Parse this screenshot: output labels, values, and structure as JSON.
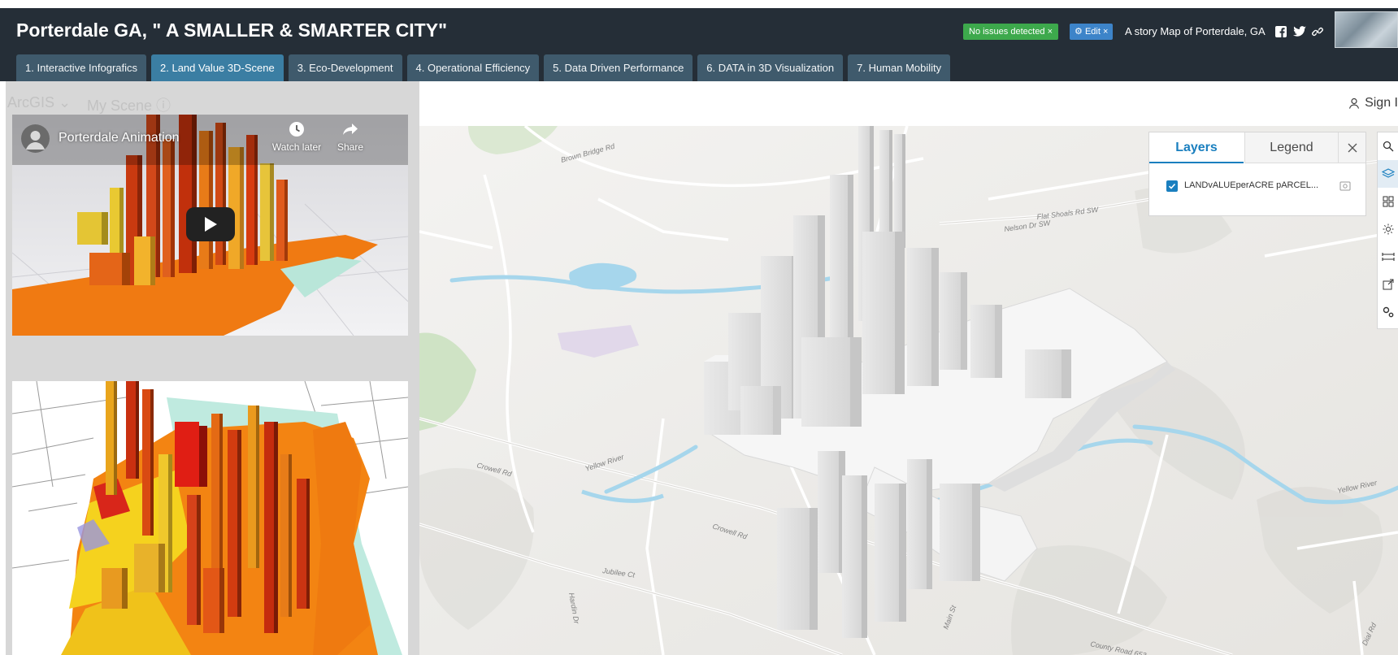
{
  "header": {
    "title": "Porterdale GA, \" A SMALLER & SMARTER CITY\"",
    "status_badge": "No issues detected ×",
    "edit_badge": "Edit ×",
    "story_link": "A story Map of Porterdale, GA",
    "icons": [
      "facebook-icon",
      "twitter-icon",
      "link-icon"
    ]
  },
  "tabs": [
    {
      "label": "1. Interactive Infografics",
      "active": false
    },
    {
      "label": "2. Land Value 3D-Scene",
      "active": true
    },
    {
      "label": "3. Eco-Development",
      "active": false
    },
    {
      "label": "4. Operational Efficiency",
      "active": false
    },
    {
      "label": "5. Data Driven Performance",
      "active": false
    },
    {
      "label": "6. DATA in 3D Visualization",
      "active": false
    },
    {
      "label": "7. Human Mobility",
      "active": false
    }
  ],
  "scene": {
    "brand": "ArcGIS",
    "scene_name": "My Scene",
    "sign_in": "Sign I"
  },
  "video": {
    "title": "Porterdale Animation",
    "watch_later": "Watch later",
    "share": "Share"
  },
  "layers_panel": {
    "tab_layers": "Layers",
    "tab_legend": "Legend",
    "layer_name": "LANDvALUEperACRE pARCEL...",
    "layer_checked": true
  },
  "tools": [
    "search-icon",
    "layers-icon",
    "basemap-icon",
    "daylight-icon",
    "measure-icon",
    "share-icon",
    "settings-icon"
  ],
  "map_labels": {
    "l1": "Brown Bridge Rd",
    "l2": "Flat Shoals Rd SW",
    "l3": "Nelson Dr SW",
    "l4": "Yellow River",
    "l5": "Crowell Rd",
    "l6": "Yellow River",
    "l7": "Jubilee Ct",
    "l8": "Crowell Rd",
    "l9": "Hardin Dr",
    "l10": "County Road 653",
    "l11": "Dial Rd",
    "l12": "Main St"
  },
  "colors": {
    "header_bg": "#252e37",
    "tab_bg": "#3f5a6c",
    "tab_active": "#3b7ea3",
    "river": "#a6d6ec",
    "accent": "#1a7fbf",
    "ok_badge": "#3da94c"
  }
}
